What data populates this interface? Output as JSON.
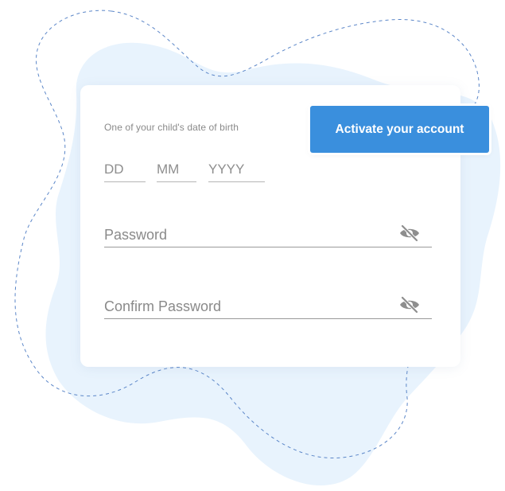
{
  "form": {
    "dob_label": "One of your child's date of birth",
    "dob_day_placeholder": "DD",
    "dob_month_placeholder": "MM",
    "dob_year_placeholder": "YYYY",
    "password_label": "Password",
    "confirm_password_label": "Confirm Password",
    "visibility_icon": "eye-off-icon"
  },
  "actions": {
    "activate_label": "Activate your account"
  },
  "colors": {
    "accent": "#3a8fdd",
    "blob_fill": "#e8f3fd",
    "dashed_line": "#5b86c8"
  }
}
